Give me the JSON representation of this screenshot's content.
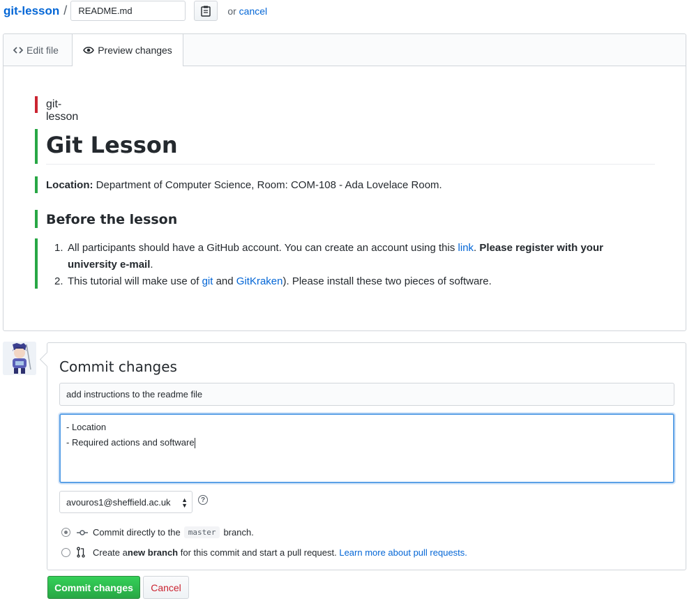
{
  "breadcrumb": {
    "repo": "git-lesson",
    "separator": "/",
    "filename_value": "README.md",
    "or_text": "or",
    "cancel_link": "cancel"
  },
  "tabs": [
    {
      "label": "Edit file",
      "icon": "code-icon",
      "active": false
    },
    {
      "label": "Preview changes",
      "icon": "eye-icon",
      "active": true
    }
  ],
  "preview": {
    "deleted_line": "git-lesson",
    "heading": "Git Lesson",
    "location_label": "Location:",
    "location_text": " Department of Computer Science, Room: COM-108 - Ada Lovelace Room.",
    "subheading": "Before the lesson",
    "list": [
      {
        "number": "1.",
        "pre": "All participants should have a GitHub account. You can create an account using this ",
        "link": "link",
        "post": ". ",
        "bold": "Please register with your university e-mail",
        "end": "."
      },
      {
        "number": "2.",
        "pre": "This tutorial will make use of ",
        "link1": "git",
        "mid": " and ",
        "link2": "GitKraken",
        "end": "). Please install these two pieces of software."
      }
    ],
    "colors": {
      "deleted": "#cb2431",
      "added": "#28a745"
    }
  },
  "commit": {
    "title": "Commit changes",
    "summary_value": "add instructions to the readme file",
    "description_lines": [
      "- Location",
      "- Required actions and software"
    ],
    "email_selected": "avouros1@sheffield.ac.uk",
    "option_direct": {
      "pre": "Commit directly to the",
      "branch": "master",
      "post": "branch."
    },
    "option_branch": {
      "pre": "Create a ",
      "bold": "new branch",
      "post": " for this commit and start a pull request. ",
      "link": "Learn more about pull requests."
    },
    "submit_label": "Commit changes",
    "cancel_label": "Cancel"
  }
}
